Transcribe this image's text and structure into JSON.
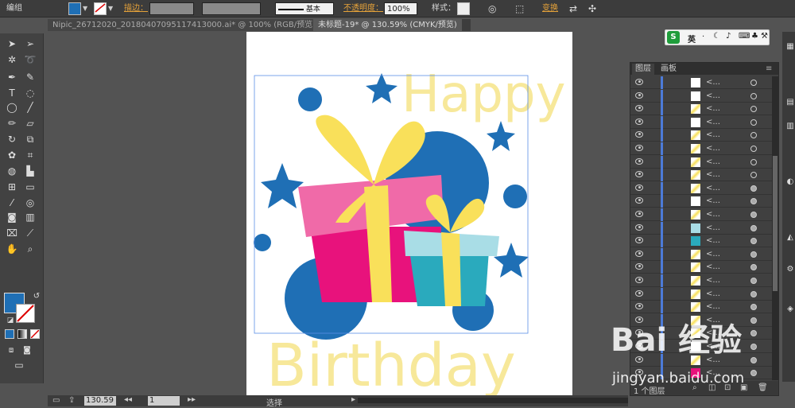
{
  "control_bar": {
    "mode_label": "编组",
    "stroke_label": "描边：",
    "stroke_style": "基本",
    "opacity_label": "不透明度：",
    "opacity_value": "100%",
    "style_label": "样式：",
    "transform_label": "变换",
    "fill_color": "#1f6fb5"
  },
  "doc_tabs": [
    {
      "label": "Nipic_26712020_20180407095117413000.ai* @ 100% (RGB/预览)"
    },
    {
      "label": "未标题-19* @ 130.59% (CMYK/预览)"
    }
  ],
  "artwork": {
    "word1": "Happy",
    "word2": "Birthday",
    "text_color": "#f7e89a",
    "blue": "#1f6fb5",
    "pink": "#e8127c",
    "pink_light": "#f06aa8",
    "yellow": "#f9e05a",
    "teal": "#2aaabd",
    "teal_light": "#a9dde6"
  },
  "layers_panel": {
    "tab_layers": "图层",
    "tab_artboards": "画板",
    "item_label": "<...",
    "layer_count_label": "1 个图层",
    "row_count": 23
  },
  "status_bar": {
    "zoom": "130.59",
    "artboard_number": "1",
    "mode_label": "选择"
  },
  "ime_bar": {
    "label": "英"
  },
  "watermark": {
    "brand": "Bai 经验",
    "url": "jingyan.baidu.com"
  }
}
